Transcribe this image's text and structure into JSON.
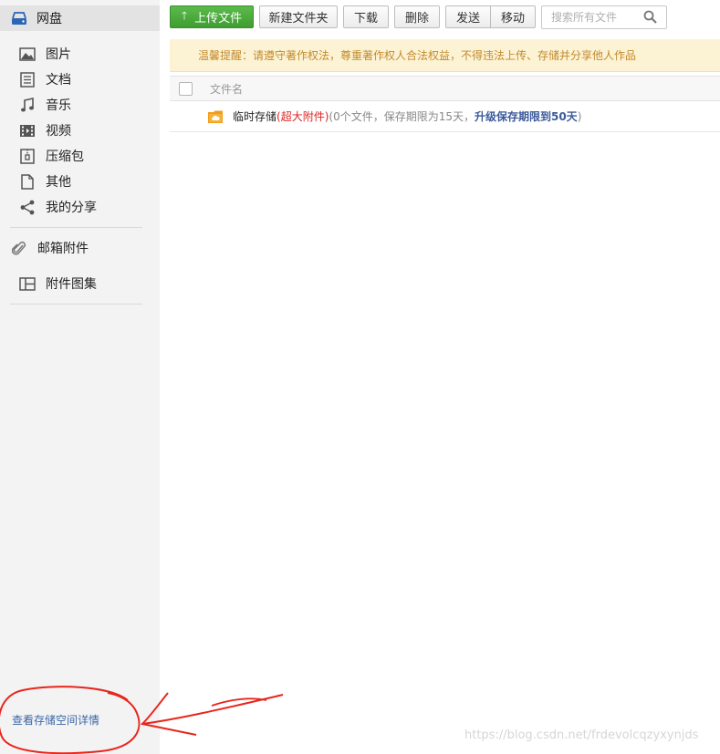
{
  "sidebar": {
    "header": {
      "label": "网盘",
      "icon": "drive-icon"
    },
    "items": [
      {
        "label": "图片",
        "icon": "image-icon"
      },
      {
        "label": "文档",
        "icon": "document-icon"
      },
      {
        "label": "音乐",
        "icon": "music-icon"
      },
      {
        "label": "视频",
        "icon": "video-icon"
      },
      {
        "label": "压缩包",
        "icon": "archive-icon"
      },
      {
        "label": "其他",
        "icon": "file-icon"
      },
      {
        "label": "我的分享",
        "icon": "share-icon"
      }
    ],
    "mail_attachments": {
      "label": "邮箱附件",
      "icon": "paperclip-icon"
    },
    "attachment_gallery": {
      "label": "附件图集",
      "icon": "gallery-icon"
    },
    "storage_details_link": "查看存储空间详情"
  },
  "toolbar": {
    "upload": "上传文件",
    "new_folder": "新建文件夹",
    "download": "下载",
    "delete": "删除",
    "send": "发送",
    "move": "移动",
    "search_placeholder": "搜索所有文件"
  },
  "notice": "温馨提醒：请遵守著作权法，尊重著作权人合法权益，不得违法上传、存储并分享他人作品",
  "table": {
    "column_name": "文件名",
    "rows": [
      {
        "name": "临时存储",
        "tag": "(超大附件)",
        "info": "(0个文件，保存期限为15天，",
        "upgrade_link": "升级保存期限到50天",
        "close": ")"
      }
    ]
  },
  "watermark": "https://blog.csdn.net/frdevolcqzyxynjds",
  "colors": {
    "primary_button": "#4cae3e",
    "notice_bg": "#fcf3d5",
    "notice_text": "#c48a2c",
    "link": "#3b5a9a",
    "annotation_red": "#e8261d"
  }
}
